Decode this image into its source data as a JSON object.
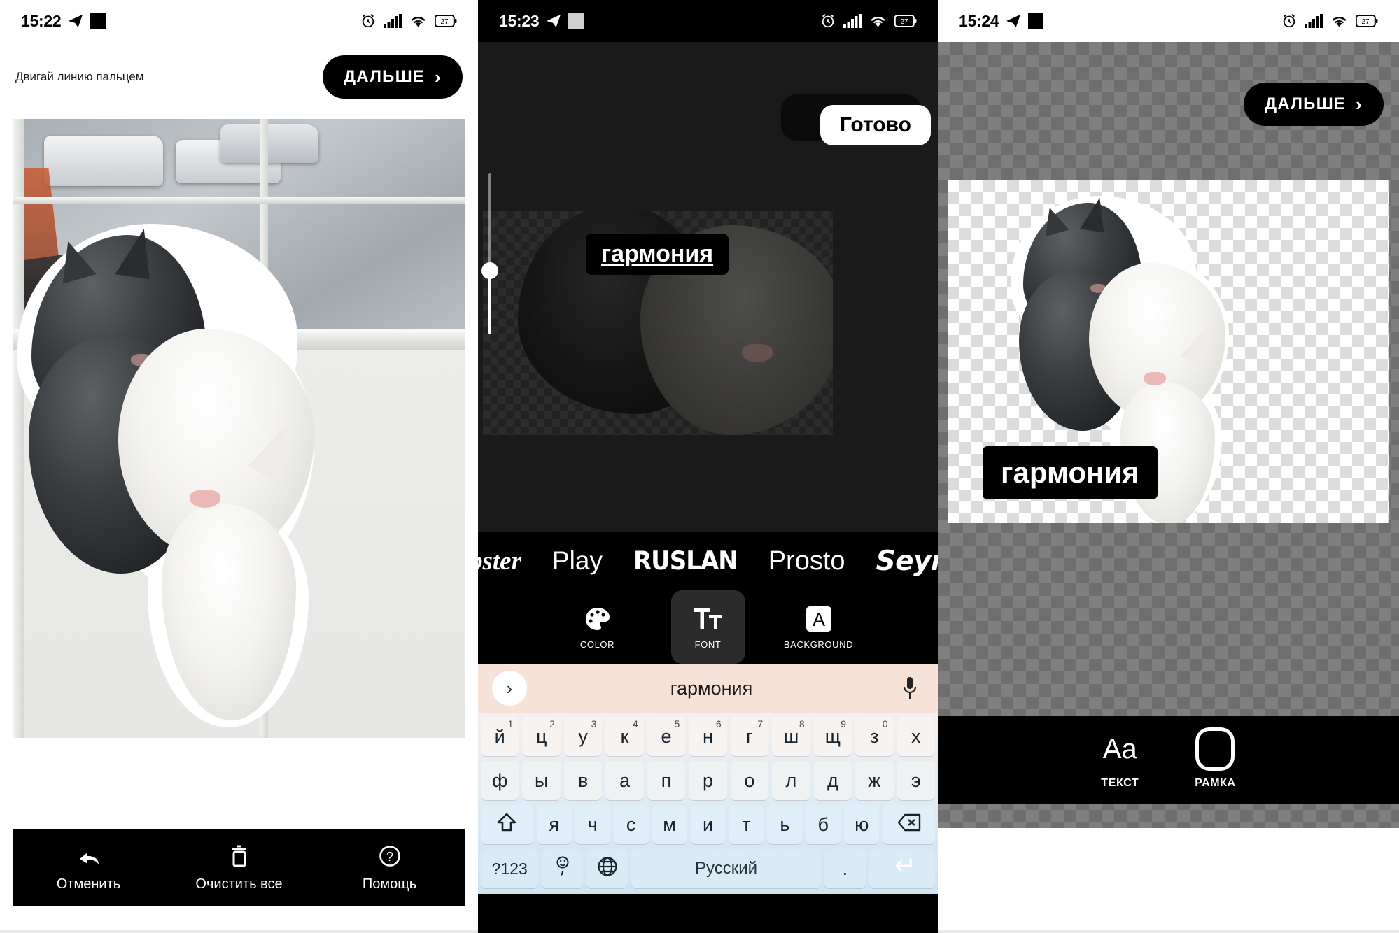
{
  "panels": [
    {
      "id": "cutout-editor",
      "statusbar": {
        "time": "15:22",
        "icons": [
          "telegram-icon",
          "square-icon",
          "alarm-icon",
          "signal-icon",
          "wifi-icon",
          "battery-icon"
        ],
        "battery_level": "27"
      },
      "hint": "Двигай линию пальцем",
      "next_button": "ДАЛЬШЕ",
      "tools": [
        {
          "label": "Отменить",
          "icon": "undo-icon"
        },
        {
          "label": "Очистить все",
          "icon": "trash-icon"
        },
        {
          "label": "Помощь",
          "icon": "help-icon"
        }
      ]
    },
    {
      "id": "text-editor",
      "statusbar": {
        "time": "15:23",
        "icons": [
          "telegram-icon",
          "square-icon",
          "alarm-icon",
          "signal-icon",
          "wifi-icon",
          "battery-icon"
        ],
        "battery_level": "27"
      },
      "done_button": "Готово",
      "sticker_text": "гармония",
      "fonts": [
        "bster",
        "Play",
        "RUSLAN",
        "Prosto",
        "Seymou"
      ],
      "tools": [
        {
          "label": "COLOR",
          "icon": "palette-icon",
          "active": false
        },
        {
          "label": "FONT",
          "icon": "font-tt-icon",
          "active": true
        },
        {
          "label": "BACKGROUND",
          "icon": "background-a-icon",
          "active": false
        }
      ],
      "keyboard": {
        "suggestion": "гармония",
        "expand_icon": "chevron-right-icon",
        "mic_icon": "microphone-icon",
        "row1": [
          {
            "key": "й",
            "sup": "1"
          },
          {
            "key": "ц",
            "sup": "2"
          },
          {
            "key": "у",
            "sup": "3"
          },
          {
            "key": "к",
            "sup": "4"
          },
          {
            "key": "е",
            "sup": "5"
          },
          {
            "key": "н",
            "sup": "6"
          },
          {
            "key": "г",
            "sup": "7"
          },
          {
            "key": "ш",
            "sup": "8"
          },
          {
            "key": "щ",
            "sup": "9"
          },
          {
            "key": "з",
            "sup": "0"
          },
          {
            "key": "х",
            "sup": ""
          }
        ],
        "row2": [
          "ф",
          "ы",
          "в",
          "а",
          "п",
          "р",
          "о",
          "л",
          "д",
          "ж",
          "э"
        ],
        "row3": [
          "я",
          "ч",
          "с",
          "м",
          "и",
          "т",
          "ь",
          "б",
          "ю"
        ],
        "shift_icon": "shift-icon",
        "backspace_icon": "backspace-icon",
        "symbols_key": "?123",
        "emoji_key": "emoji-comma-icon",
        "globe_key": "globe-icon",
        "space_key": "Русский",
        "period_key": ".",
        "enter_icon": "enter-icon"
      }
    },
    {
      "id": "sticker-preview",
      "statusbar": {
        "time": "15:24",
        "icons": [
          "telegram-icon",
          "square-icon",
          "alarm-icon",
          "signal-icon",
          "wifi-icon",
          "battery-icon"
        ],
        "battery_level": "27"
      },
      "next_button": "ДАЛЬШЕ",
      "sticker_text": "гармония",
      "tools": [
        {
          "label": "ТЕКСТ",
          "icon": "text-aa-icon"
        },
        {
          "label": "РАМКА",
          "icon": "frame-icon"
        }
      ]
    }
  ],
  "colors": {
    "black": "#000000",
    "white": "#ffffff",
    "keyboard_suggestion_bg": "#f7e2d8",
    "keyboard_bg": "#cfe4f2",
    "enter_blue": "#36a3e0",
    "active_tool_bg": "#2b2b2b"
  }
}
